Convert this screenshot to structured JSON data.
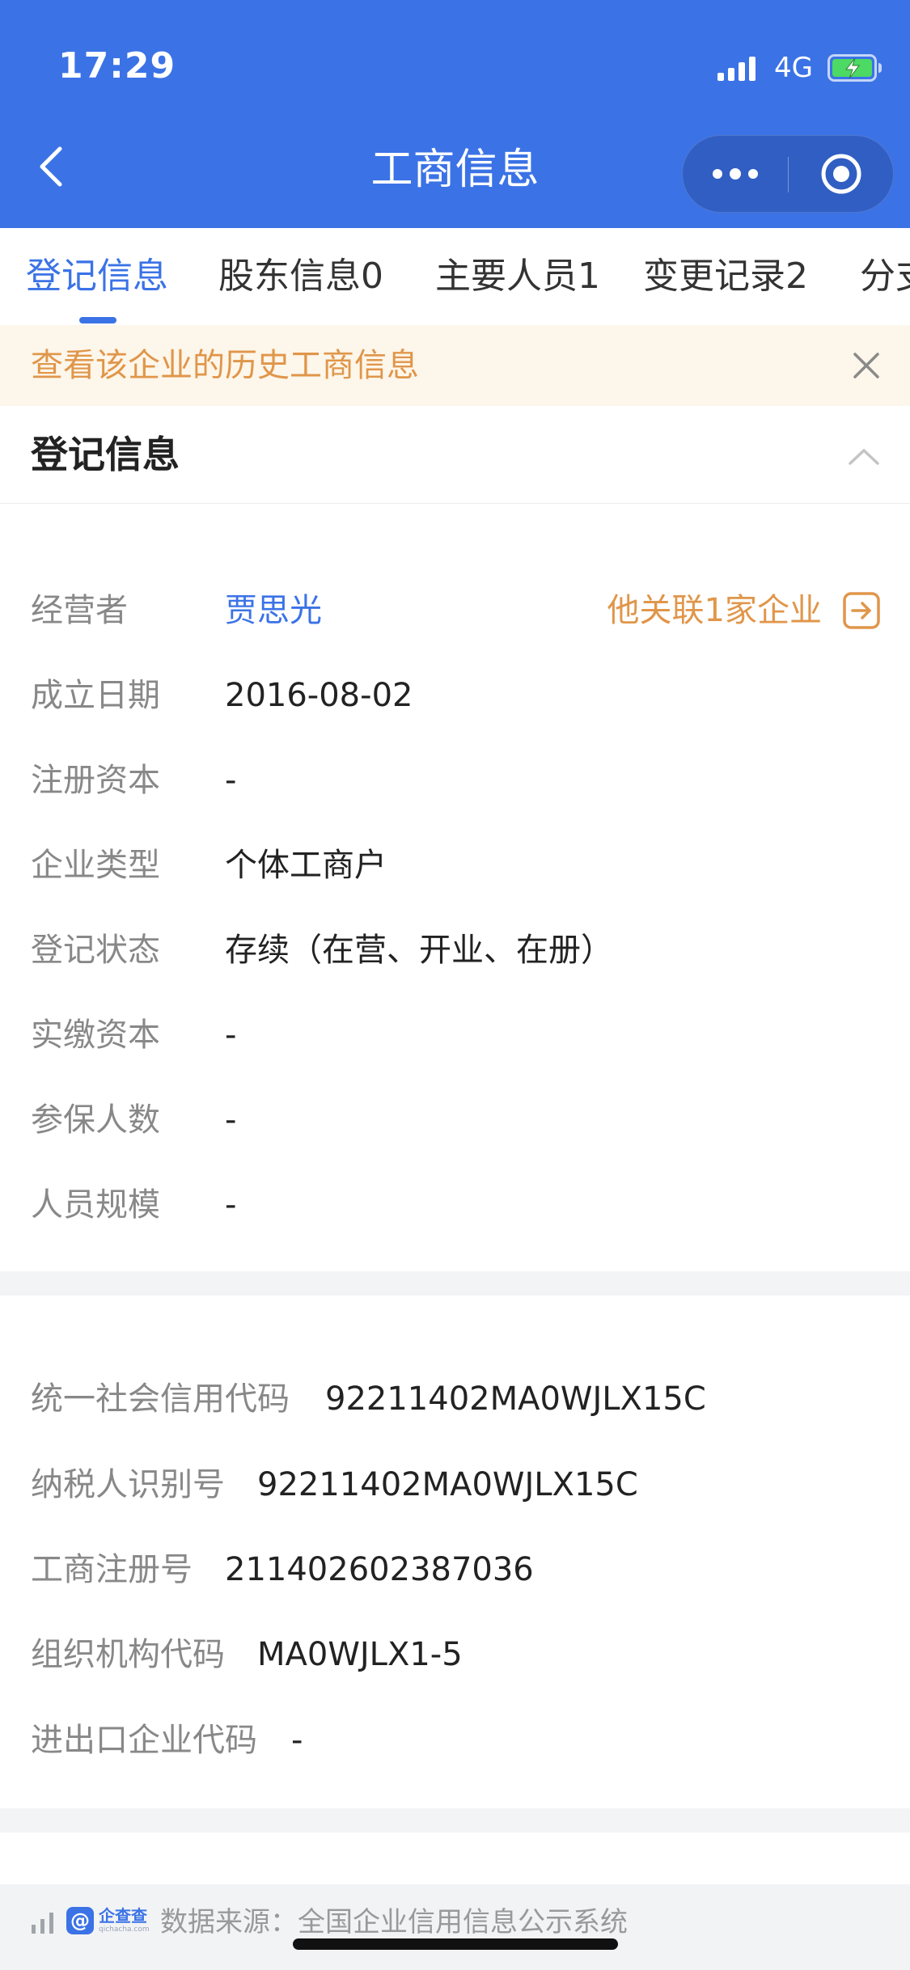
{
  "status_bar": {
    "time": "17:29",
    "network": "4G"
  },
  "nav": {
    "title": "工商信息"
  },
  "tabs": [
    {
      "label": "登记信息",
      "active": true
    },
    {
      "label": "股东信息0",
      "active": false
    },
    {
      "label": "主要人员1",
      "active": false
    },
    {
      "label": "变更记录2",
      "active": false
    },
    {
      "label": "分支",
      "active": false
    }
  ],
  "notice": {
    "text": "查看该企业的历史工商信息"
  },
  "section": {
    "title": "登记信息"
  },
  "registration": {
    "operator": {
      "label": "经营者",
      "value": "贾思光",
      "related_text": "他关联1家企业"
    },
    "founded": {
      "label": "成立日期",
      "value": "2016-08-02"
    },
    "reg_capital": {
      "label": "注册资本",
      "value": "-"
    },
    "company_type": {
      "label": "企业类型",
      "value": "个体工商户"
    },
    "reg_status": {
      "label": "登记状态",
      "value": "存续（在营、开业、在册）"
    },
    "paid_capital": {
      "label": "实缴资本",
      "value": "-"
    },
    "insured_count": {
      "label": "参保人数",
      "value": "-"
    },
    "staff_size": {
      "label": "人员规模",
      "value": "-"
    }
  },
  "codes": {
    "credit_code": {
      "label": "统一社会信用代码",
      "value": "92211402MA0WJLX15C"
    },
    "taxpayer_id": {
      "label": "纳税人识别号",
      "value": "92211402MA0WJLX15C"
    },
    "business_reg_no": {
      "label": "工商注册号",
      "value": "211402602387036"
    },
    "org_code": {
      "label": "组织机构代码",
      "value": "MA0WJLX1-5"
    },
    "import_export_code": {
      "label": "进出口企业代码",
      "value": "-"
    }
  },
  "footer": {
    "logo_cn": "企查查",
    "logo_en": "qichacha.com",
    "logo_mark": "@",
    "source_text": "数据来源：全国企业信用信息公示系统"
  },
  "colors": {
    "brand_blue": "#3b73e6",
    "accent_orange": "#e0964a",
    "notice_bg": "#fdf6ea",
    "battery_green": "#4cd964"
  }
}
